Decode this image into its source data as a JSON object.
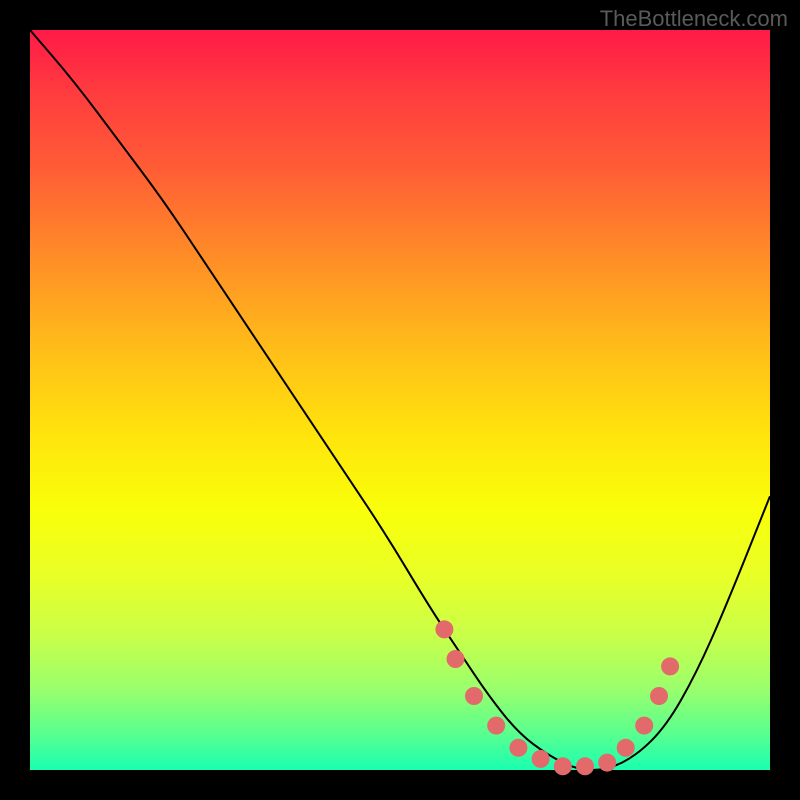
{
  "watermark": "TheBottleneck.com",
  "chart_data": {
    "type": "line",
    "title": "",
    "xlabel": "",
    "ylabel": "",
    "xlim": [
      0,
      100
    ],
    "ylim": [
      0,
      100
    ],
    "series": [
      {
        "name": "curve",
        "x": [
          0,
          6,
          12,
          18,
          24,
          30,
          36,
          42,
          48,
          54,
          58,
          62,
          66,
          70,
          74,
          78,
          82,
          86,
          90,
          94,
          100
        ],
        "y": [
          100,
          93,
          85,
          77,
          68,
          59,
          50,
          41,
          32,
          22,
          16,
          10,
          5,
          2,
          0,
          0,
          2,
          6,
          13,
          22,
          37
        ]
      }
    ],
    "markers": {
      "name": "highlight-points",
      "color": "#e26a6a",
      "x": [
        56,
        57.5,
        60,
        63,
        66,
        69,
        72,
        75,
        78,
        80.5,
        83,
        85,
        86.5
      ],
      "y": [
        19,
        15,
        10,
        6,
        3,
        1.5,
        0.5,
        0.5,
        1,
        3,
        6,
        10,
        14
      ]
    },
    "background_gradient": {
      "top": "#ff1a47",
      "bottom": "#1affb0"
    }
  }
}
